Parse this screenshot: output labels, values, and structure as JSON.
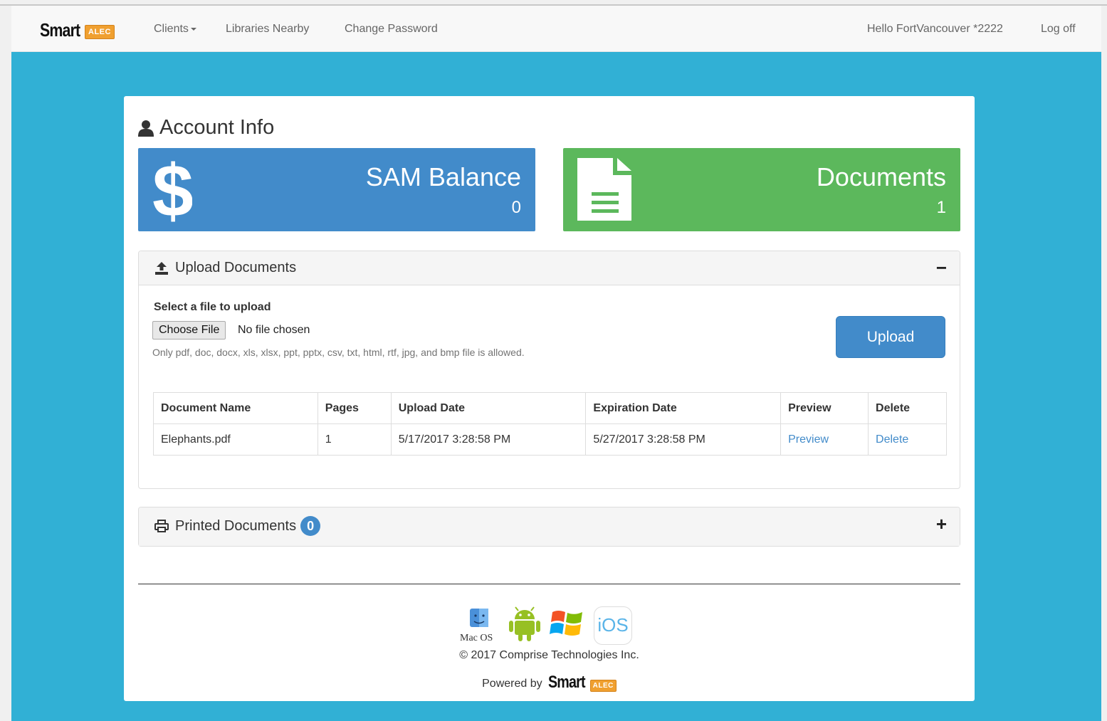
{
  "nav": {
    "brand_name": "Smart",
    "brand_tag": "ALEC",
    "links": [
      "Clients",
      "Libraries Nearby",
      "Change Password"
    ],
    "greeting": "Hello FortVancouver *2222",
    "logoff": "Log off"
  },
  "page": {
    "title": "Account Info"
  },
  "tiles": {
    "balance": {
      "title": "SAM Balance",
      "value": "0",
      "icon": "dollar-icon",
      "color": "#428bca"
    },
    "documents": {
      "title": "Documents",
      "value": "1",
      "icon": "file-text-icon",
      "color": "#5cb85c"
    }
  },
  "upload_panel": {
    "title": "Upload Documents",
    "toggle": "−",
    "select_label": "Select a file to upload",
    "choose_button": "Choose File",
    "no_file": "No file chosen",
    "help_text": "Only pdf, doc, docx, xls, xlsx, ppt, pptx, csv, txt, html, rtf, jpg, and bmp file is allowed.",
    "upload_button": "Upload"
  },
  "docs_table": {
    "headers": [
      "Document Name",
      "Pages",
      "Upload Date",
      "Expiration Date",
      "Preview",
      "Delete"
    ],
    "rows": [
      {
        "name": "Elephants.pdf",
        "pages": "1",
        "upload_date": "5/17/2017 3:28:58 PM",
        "expiration_date": "5/27/2017 3:28:58 PM",
        "preview": "Preview",
        "delete": "Delete"
      }
    ]
  },
  "print_panel": {
    "title": "Printed Documents",
    "count": "0",
    "toggle": "+"
  },
  "footer": {
    "os_labels": [
      "Mac OS",
      "Android",
      "Windows",
      "iOS"
    ],
    "copyright": "© 2017 Comprise Technologies Inc.",
    "powered_by": "Powered by",
    "powered_brand": "Smart",
    "powered_tag": "ALEC"
  },
  "colors": {
    "background": "#31b0d5",
    "primary": "#428bca",
    "success": "#5cb85c"
  }
}
